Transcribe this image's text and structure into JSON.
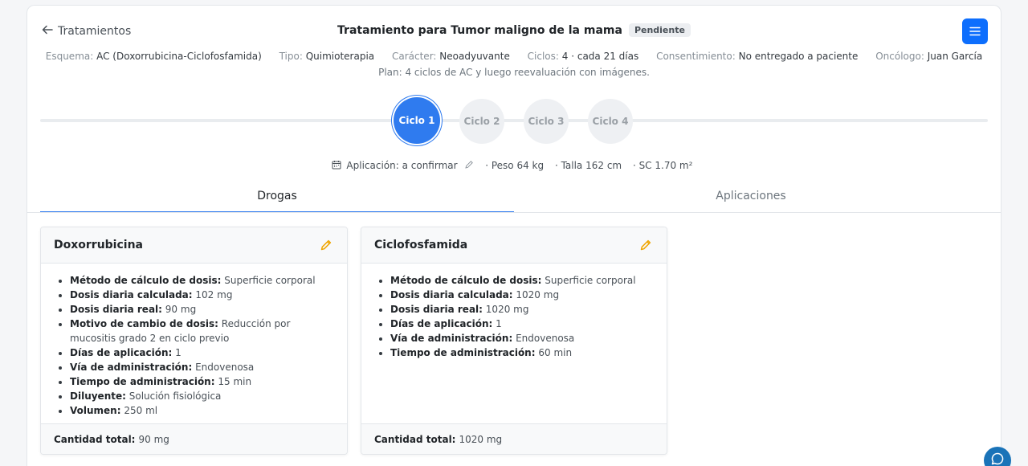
{
  "header": {
    "back_label": "Tratamientos",
    "title": "Tratamiento para Tumor maligno de la mama",
    "status": "Pendiente",
    "menu_icon": "hamburger-icon"
  },
  "meta": [
    {
      "label": "Esquema:",
      "value": "AC (Doxorrubicina-Ciclofosfamida)"
    },
    {
      "label": "Tipo:",
      "value": "Quimioterapia"
    },
    {
      "label": "Carácter:",
      "value": "Neoadyuvante"
    },
    {
      "label": "Ciclos:",
      "value": "4 · cada 21 días"
    },
    {
      "label": "Consentimiento:",
      "value": "No entregado a paciente"
    },
    {
      "label": "Oncólogo:",
      "value": "Juan García"
    }
  ],
  "plan": "Plan: 4 ciclos de AC y luego reevaluación con imágenes.",
  "cycles": [
    "Ciclo 1",
    "Ciclo 2",
    "Ciclo 3",
    "Ciclo 4"
  ],
  "active_cycle": 0,
  "cycle_info": {
    "application": "Aplicación: a confirmar",
    "weight": "· Peso 64 kg",
    "height": "· Talla 162 cm",
    "bsa": "· SC 1.70 m²"
  },
  "tabs": [
    "Drogas",
    "Aplicaciones"
  ],
  "active_tab": 0,
  "drugs": [
    {
      "name": "Doxorrubicina",
      "details": [
        {
          "label": "Método de cálculo de dosis:",
          "value": "Superficie corporal"
        },
        {
          "label": "Dosis diaria calculada:",
          "value": "102 mg"
        },
        {
          "label": "Dosis diaria real:",
          "value": "90 mg"
        },
        {
          "label": "Motivo de cambio de dosis:",
          "value": "Reducción por mucositis grado 2 en ciclo previo"
        },
        {
          "label": "Días de aplicación:",
          "value": "1"
        },
        {
          "label": "Vía de administración:",
          "value": "Endovenosa"
        },
        {
          "label": "Tiempo de administración:",
          "value": "15 min"
        },
        {
          "label": "Diluyente:",
          "value": "Solución fisiológica"
        },
        {
          "label": "Volumen:",
          "value": "250 ml"
        }
      ],
      "total_label": "Cantidad total:",
      "total_value": "90 mg"
    },
    {
      "name": "Ciclofosfamida",
      "details": [
        {
          "label": "Método de cálculo de dosis:",
          "value": "Superficie corporal"
        },
        {
          "label": "Dosis diaria calculada:",
          "value": "1020 mg"
        },
        {
          "label": "Dosis diaria real:",
          "value": "1020 mg"
        },
        {
          "label": "Días de aplicación:",
          "value": "1"
        },
        {
          "label": "Vía de administración:",
          "value": "Endovenosa"
        },
        {
          "label": "Tiempo de administración:",
          "value": "60 min"
        }
      ],
      "total_label": "Cantidad total:",
      "total_value": "1020 mg"
    }
  ],
  "colors": {
    "primary": "#2f7bef",
    "menu_button": "#0d6efd",
    "edit_icon": "#f0a500",
    "chat_button": "#1a73b8"
  }
}
